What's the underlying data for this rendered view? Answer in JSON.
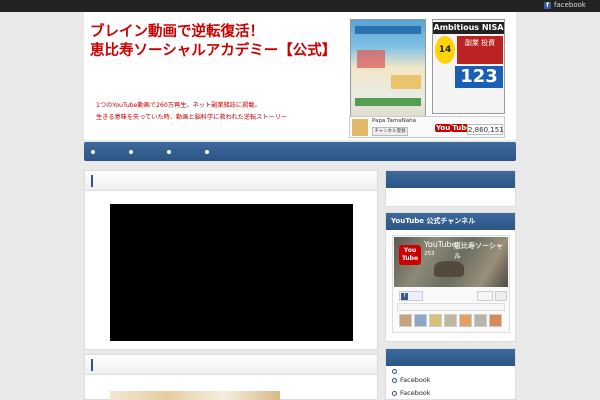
{
  "topbar": {
    "facebook_label": "facebook",
    "fb_icon": "f"
  },
  "header": {
    "title_line1": "ブレイン動画で逆転復活！",
    "title_line2": "恵比寿ソーシャルアカデミー【公式】",
    "tagline_line1": "1つのYouTube動画で260万再生、ネット副業雑誌に掲載。",
    "tagline_line2": "生きる意味を失っていた時、動画と脳科学に救われた逆転ストーリー"
  },
  "magazine": {
    "title": "Ambitious NISA",
    "badge": "14",
    "red_text": "副業 投資",
    "big_number": "123"
  },
  "youtube_widget": {
    "channel_name": "Papa TamaNaha",
    "subscribe_label": "チャンネル登録",
    "logo_you": "You",
    "logo_tube": "Tube",
    "count": "2,860,151"
  },
  "nav": {
    "items": [
      "",
      "",
      "",
      ""
    ]
  },
  "sidebar": {
    "box2_title": "YouTube 公式チャンネル",
    "yt_title": "YouTube",
    "yt_count": "253",
    "yt_badge": "You Tube",
    "yt_brand": "恵比寿ソーシャル",
    "links": [
      "",
      "Facebook",
      "Facebook"
    ]
  },
  "colors": {
    "accent": "#2b5585",
    "title_red": "#cc0000"
  }
}
